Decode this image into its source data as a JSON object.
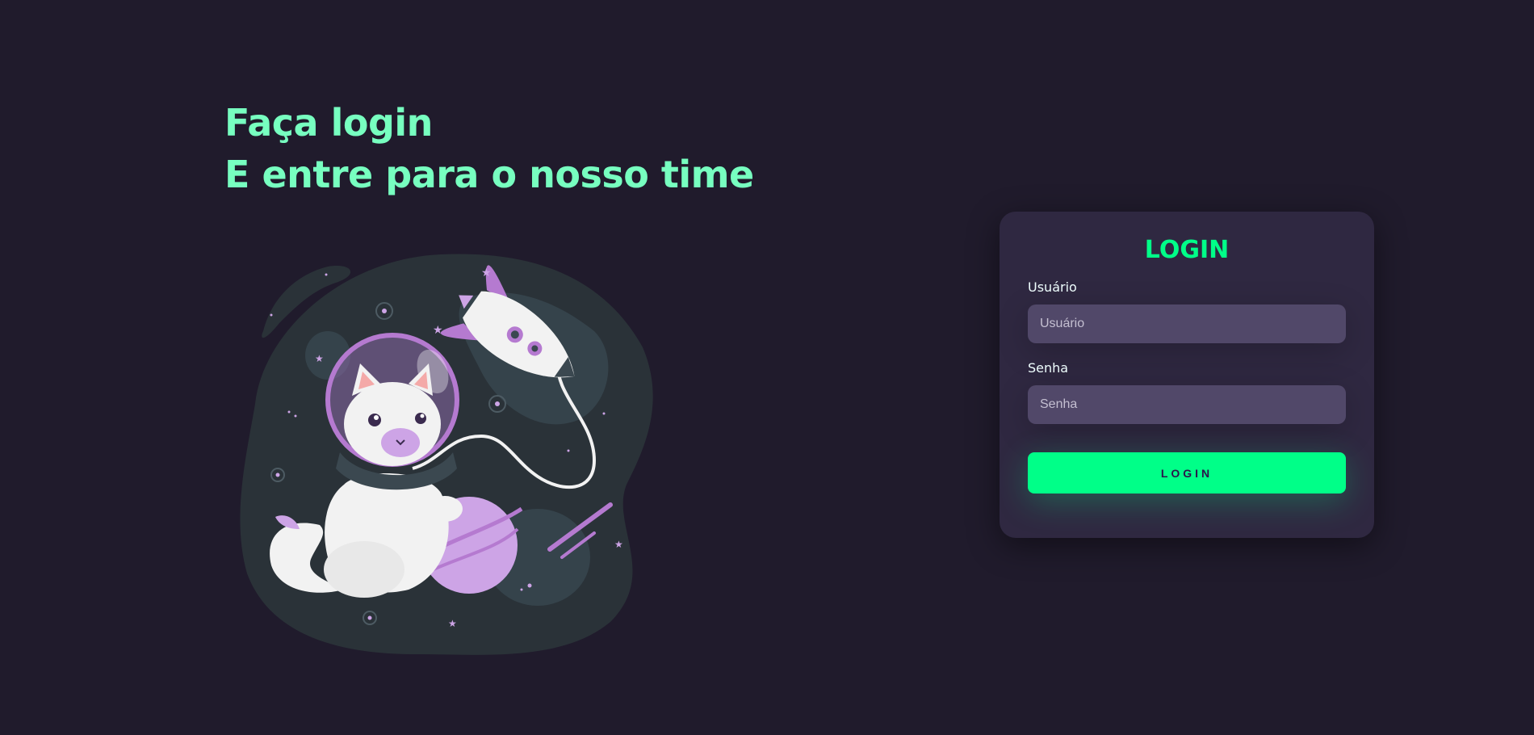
{
  "hero": {
    "line1": "Faça login",
    "line2": "E entre para o nosso time"
  },
  "illustration": {
    "icon": "astronaut-cat-icon"
  },
  "login_card": {
    "title": "LOGIN",
    "username_label": "Usuário",
    "username_placeholder": "Usuário",
    "username_value": "",
    "password_label": "Senha",
    "password_placeholder": "Senha",
    "password_value": "",
    "button_label": "LOGIN"
  },
  "colors": {
    "background": "#201b2c",
    "card": "#2f2841",
    "input": "#514869",
    "accent": "#00ff88",
    "headline": "#77ffc0"
  }
}
